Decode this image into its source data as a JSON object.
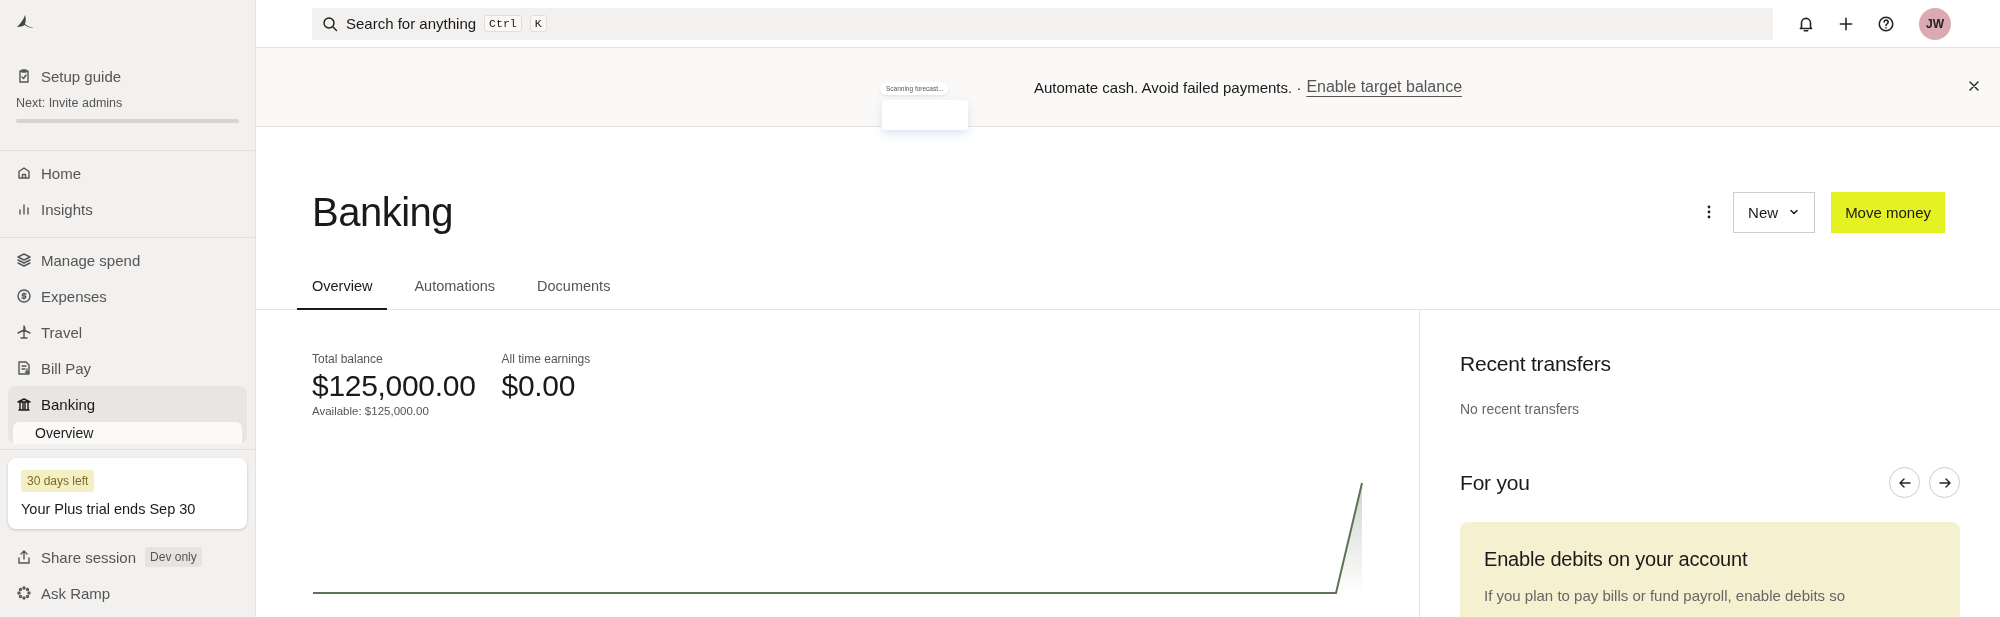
{
  "sidebar": {
    "setup_guide": {
      "label": "Setup guide",
      "next": "Next: Invite admins",
      "level": 0
    },
    "nav_groups": [
      [
        {
          "label": "Home",
          "selected": false
        },
        {
          "label": "Insights",
          "selected": false
        }
      ],
      [
        {
          "label": "Manage spend",
          "selected": false
        },
        {
          "label": "Expenses",
          "selected": false
        },
        {
          "label": "Travel",
          "selected": false
        },
        {
          "label": "Bill Pay",
          "selected": false
        },
        {
          "label": "Banking",
          "selected": true,
          "children": [
            {
              "label": "Overview",
              "selected": true
            }
          ]
        }
      ]
    ],
    "trial": {
      "badge": "30 days left",
      "text": "Your Plus trial ends Sep 30"
    },
    "footer_items": [
      {
        "label": "Share session",
        "badge": "Dev only"
      },
      {
        "label": "Ask Ramp"
      }
    ]
  },
  "top_bar": {
    "search": {
      "placeholder": "Search for anything",
      "keys": [
        "Ctrl",
        "K"
      ]
    },
    "avatar": "JW"
  },
  "banner": {
    "illustration_text": "Scanning forecast...",
    "message": "Automate cash. Avoid failed payments. ·",
    "link": "Enable target balance"
  },
  "header": {
    "title": "Banking",
    "buttons": [
      "New",
      "Move money"
    ]
  },
  "tabs": [
    {
      "label": "Overview",
      "selected": true
    },
    {
      "label": "Automations",
      "selected": false
    },
    {
      "label": "Documents",
      "selected": false
    }
  ],
  "balances": [
    {
      "label": "Total balance",
      "value": "$125,000.00",
      "note": "Available: $125,000.00"
    },
    {
      "label": "All time earnings",
      "value": "$0.00"
    }
  ],
  "recent_transfers": {
    "title": "Recent transfers",
    "empty": "No recent transfers"
  },
  "for_you": {
    "title": "For you",
    "card": {
      "title": "Enable debits on your account",
      "text": "If you plan to pay bills or fund payroll, enable debits so"
    }
  }
}
